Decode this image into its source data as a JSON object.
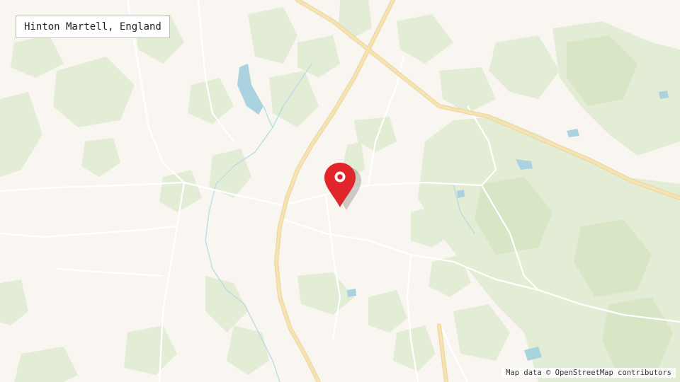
{
  "map": {
    "place_name": "Hinton Martell, England",
    "attribution": "Map data © OpenStreetMap contributors",
    "marker_icon": "map-pin-icon",
    "colors": {
      "land": "#f9f6f1",
      "woodland": "#e3ecd4",
      "woodland_dark": "#d9e6c6",
      "water": "#aad3df",
      "major_road": "#f6e3b4",
      "major_road_casing": "#ecd59a",
      "minor_road": "#ffffff",
      "river": "#b9dce6",
      "marker": "#e0262b"
    }
  }
}
